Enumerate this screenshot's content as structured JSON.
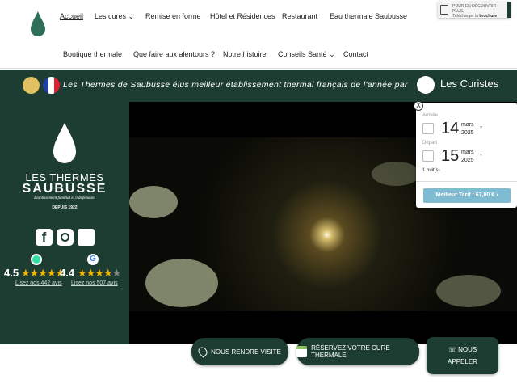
{
  "header": {
    "nav": [
      {
        "label": "Accueil",
        "active": true
      },
      {
        "label": "Les cures",
        "dropdown": true
      },
      {
        "label": "Remise en forme"
      },
      {
        "label": "Hôtel et Résidences"
      },
      {
        "label": "Restaurant"
      },
      {
        "label": "Eau thermale Saubusse"
      },
      {
        "label": "Boutique thermale"
      },
      {
        "label": "Que faire aux alentours ?"
      },
      {
        "label": "Notre histoire"
      },
      {
        "label": "Conseils Santé",
        "dropdown": true
      },
      {
        "label": "Contact"
      }
    ],
    "brochure": {
      "line1": "POUR EN DÉCOUVRIR PLUS,",
      "line2": "Télécharger la",
      "bold": "brochure"
    }
  },
  "banner": {
    "text": "Les Thermes de Saubusse élus meilleur établissement thermal français de l'année par",
    "partner": "Les Curistes"
  },
  "brand": {
    "line1": "LES THERMES",
    "line2": "SAUBUSSE",
    "tagline": "Établissement familial et indépendant",
    "since": "DEPUIS 1922"
  },
  "ratings": [
    {
      "score": "4.5",
      "stars": 4.5,
      "link": "Lisez nos 442 avis",
      "source": "tripadvisor"
    },
    {
      "score": "4.4",
      "stars": 4.4,
      "link": "Lisez nos 507 avis",
      "source": "google"
    }
  ],
  "booking": {
    "close": "X",
    "arrival_label": "Arrivée",
    "arrival_day": "14",
    "arrival_month": "mars",
    "arrival_year": "2025",
    "departure_label": "Départ",
    "departure_day": "15",
    "departure_month": "mars",
    "departure_year": "2025",
    "nights": "1 nuit(s)",
    "cta": "Meilleur Tarif : 67,00 €"
  },
  "actions": {
    "visit": "NOUS RENDRE VISITE",
    "book": "RÉSERVEZ VOTRE CURE THERMALE",
    "call1": "NOUS",
    "call2": "APPELER"
  },
  "colors": {
    "primary": "#1d3d33",
    "cta": "#7fbcd2",
    "star": "#f5b400"
  }
}
